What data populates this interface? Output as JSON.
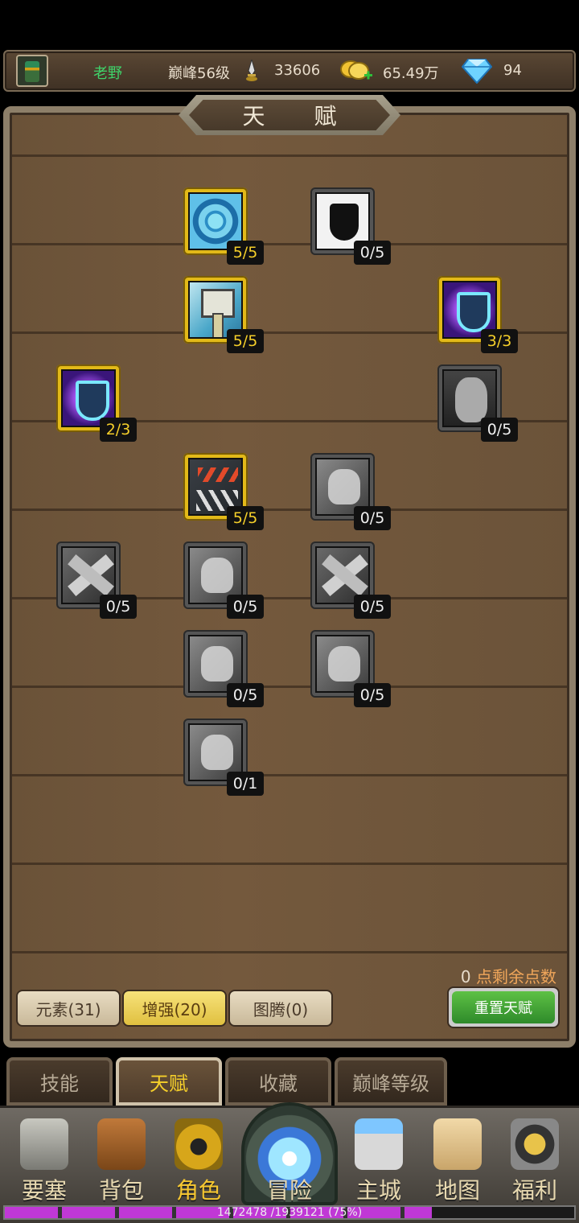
{
  "player": {
    "name": "老野",
    "level": "巅峰56级",
    "power": "33606",
    "gold": "65.49万",
    "gems": "94"
  },
  "panel": {
    "title": "天 赋"
  },
  "talents": [
    {
      "count": "5/5",
      "active": true
    },
    {
      "count": "0/5",
      "active": false
    },
    {
      "count": "5/5",
      "active": true
    },
    {
      "count": "3/3",
      "active": true
    },
    {
      "count": "2/3",
      "active": true
    },
    {
      "count": "0/5",
      "active": false
    },
    {
      "count": "5/5",
      "active": true
    },
    {
      "count": "0/5",
      "active": false
    },
    {
      "count": "0/5",
      "active": false
    },
    {
      "count": "0/5",
      "active": false
    },
    {
      "count": "0/5",
      "active": false
    },
    {
      "count": "0/5",
      "active": false
    },
    {
      "count": "0/5",
      "active": false
    },
    {
      "count": "0/1",
      "active": false
    }
  ],
  "points": {
    "value": "0",
    "label": "点剩余点数"
  },
  "categories": [
    {
      "label": "元素(31)"
    },
    {
      "label": "增强(20)",
      "selected": true
    },
    {
      "label": "图腾(0)"
    }
  ],
  "reset_label": "重置天赋",
  "sub_tabs": [
    {
      "label": "技能"
    },
    {
      "label": "天赋",
      "selected": true
    },
    {
      "label": "收藏"
    },
    {
      "label": "巅峰等级"
    }
  ],
  "nav": [
    {
      "label": "要塞",
      "icon": "fortress-icon"
    },
    {
      "label": "背包",
      "icon": "backpack-icon"
    },
    {
      "label": "角色",
      "icon": "helmet-icon",
      "selected": true
    },
    {
      "label": "冒险",
      "icon": "portal-icon"
    },
    {
      "label": "主城",
      "icon": "castle-icon"
    },
    {
      "label": "地图",
      "icon": "map-scroll-icon"
    },
    {
      "label": "福利",
      "icon": "gift-gong-icon"
    }
  ],
  "xp": {
    "text": "1472478 /1939121 (75%)",
    "fraction": 0.75
  }
}
